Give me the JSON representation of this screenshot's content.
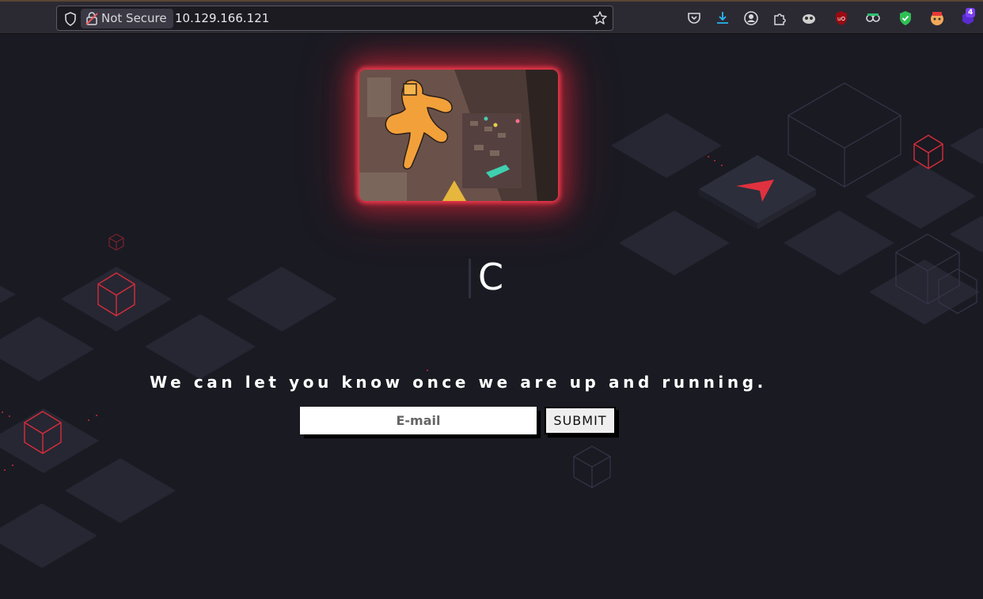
{
  "browser": {
    "security_label": "Not Secure",
    "url": "10.129.166.121",
    "extension_badge": "4",
    "icons": [
      "shield-icon",
      "lock-icon",
      "bookmark-star-icon",
      "pocket-icon",
      "download-icon",
      "account-icon",
      "extensions-icon",
      "extension-icon",
      "ublock-icon",
      "extension-icon",
      "shield-check-icon",
      "extension-icon",
      "extension-icon"
    ]
  },
  "page": {
    "heading": "C",
    "tagline": "We can let you know once we are up and running.",
    "email_placeholder": "E-mail",
    "submit_label": "SUBMIT"
  },
  "colors": {
    "background": "#1a1a22",
    "tile": "#262733",
    "accent_red": "#e0313f",
    "glow": "#e02840"
  }
}
